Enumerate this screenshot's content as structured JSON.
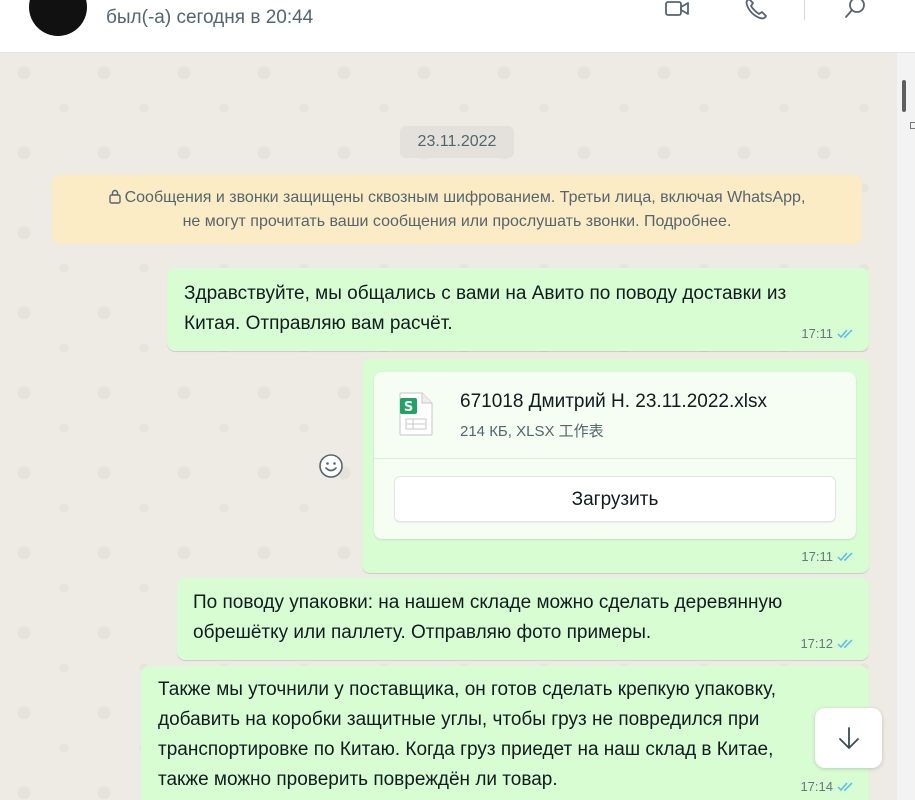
{
  "header": {
    "status": "был(-а) сегодня в 20:44",
    "icons": [
      "avatar",
      "video-call-icon",
      "voice-call-icon",
      "search-icon"
    ]
  },
  "chat": {
    "date_chip": "23.11.2022",
    "encryption_line1": "Сообщения и звонки защищены сквозным шифрованием. Третьи лица, включая WhatsApp,",
    "encryption_line2": "не могут прочитать ваши сообщения или прослушать звонки. Подробнее.",
    "messages": [
      {
        "line1": "Здравствуйте, мы общались с вами на Авито по поводу доставки из",
        "line2": "Китая. Отправляю вам расчёт.",
        "time": "17:11"
      },
      {
        "file_name": "671018 Дмитрий Н. 23.11.2022.xlsx",
        "file_meta": "214 КБ, XLSX 工作表",
        "download_label": "Загрузить",
        "time": "17:11"
      },
      {
        "line1": "По поводу упаковки: на нашем складе можно сделать деревянную",
        "line2": "обрешётку или паллету. Отправляю фото примеры.",
        "time": "17:12"
      },
      {
        "line1": "Также мы уточнили у поставщика, он готов сделать крепкую упаковку,",
        "line2": "добавить на коробки защитные углы, чтобы груз не повредился при",
        "line3": "транспортировке по Китаю. Когда груз приедет на наш склад в Китае,",
        "line4": "также можно проверить повреждён ли товар.",
        "time": "17:14"
      }
    ]
  },
  "colors": {
    "outgoing_bubble": "#d9fdd3",
    "encryption_banner": "#fbecc5",
    "read_ticks": "#53bdeb",
    "chat_background": "#eeeae4"
  }
}
